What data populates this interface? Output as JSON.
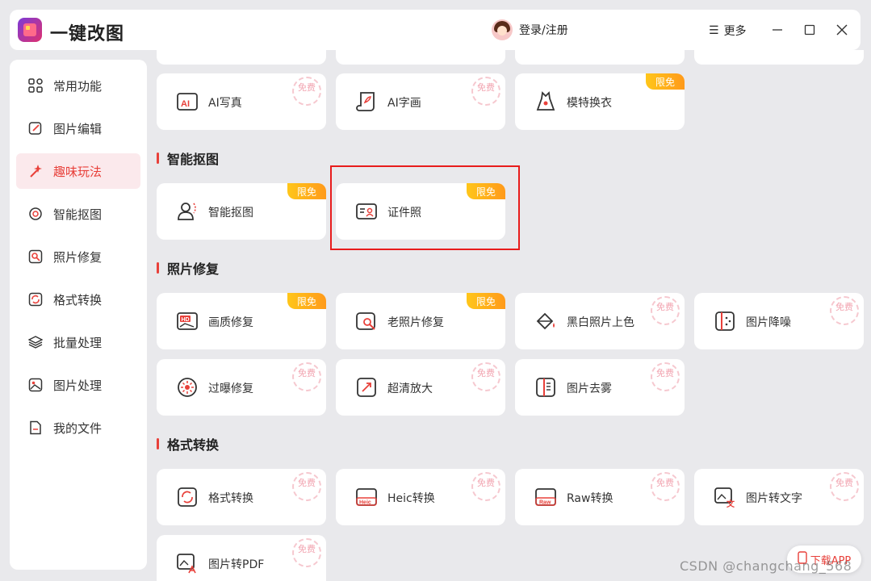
{
  "app": {
    "title": "一键改图"
  },
  "header": {
    "login_label": "登录/注册",
    "more_label": "更多"
  },
  "sidebar": {
    "items": [
      {
        "label": "常用功能",
        "icon": "grid-icon"
      },
      {
        "label": "图片编辑",
        "icon": "edit-icon"
      },
      {
        "label": "趣味玩法",
        "icon": "magic-wand-icon",
        "active": true
      },
      {
        "label": "智能抠图",
        "icon": "cutout-icon"
      },
      {
        "label": "照片修复",
        "icon": "repair-icon"
      },
      {
        "label": "格式转换",
        "icon": "convert-icon"
      },
      {
        "label": "批量处理",
        "icon": "layers-icon"
      },
      {
        "label": "图片处理",
        "icon": "image-icon"
      },
      {
        "label": "我的文件",
        "icon": "file-icon"
      }
    ]
  },
  "cards": {
    "ai_photo": {
      "label": "AI写真",
      "badge": "免费"
    },
    "ai_draw": {
      "label": "AI字画",
      "badge": "免费"
    },
    "model_outfit": {
      "label": "模特换衣",
      "badge": "限免"
    },
    "smart_cutout": {
      "label": "智能抠图",
      "badge": "限免"
    },
    "id_photo": {
      "label": "证件照",
      "badge": "限免"
    },
    "quality_fix": {
      "label": "画质修复",
      "badge": "限免"
    },
    "old_photo": {
      "label": "老照片修复",
      "badge": "限免"
    },
    "colorize": {
      "label": "黑白照片上色",
      "badge": "免费"
    },
    "denoise": {
      "label": "图片降噪",
      "badge": "免费"
    },
    "overexposure": {
      "label": "过曝修复",
      "badge": "免费"
    },
    "upscale": {
      "label": "超清放大",
      "badge": "免费"
    },
    "dehaze": {
      "label": "图片去雾",
      "badge": "免费"
    },
    "format_convert": {
      "label": "格式转换",
      "badge": "免费"
    },
    "heic_convert": {
      "label": "Heic转换",
      "badge": "免费"
    },
    "raw_convert": {
      "label": "Raw转换",
      "badge": "免费"
    },
    "img_to_text": {
      "label": "图片转文字",
      "badge": "免费"
    },
    "img_to_pdf": {
      "label": "图片转PDF",
      "badge": "免费"
    }
  },
  "sections": {
    "cutout": "智能抠图",
    "repair": "照片修复",
    "convert": "格式转换"
  },
  "icon_text": {
    "hd": "HD",
    "heic": "Heic",
    "raw": "Raw"
  },
  "watermark": "CSDN @changchang_568",
  "download_label": "下载APP",
  "colors": {
    "accent": "#e8403a",
    "badge_limit": "#ff9a1a",
    "badge_free": "#f2a4b0"
  }
}
